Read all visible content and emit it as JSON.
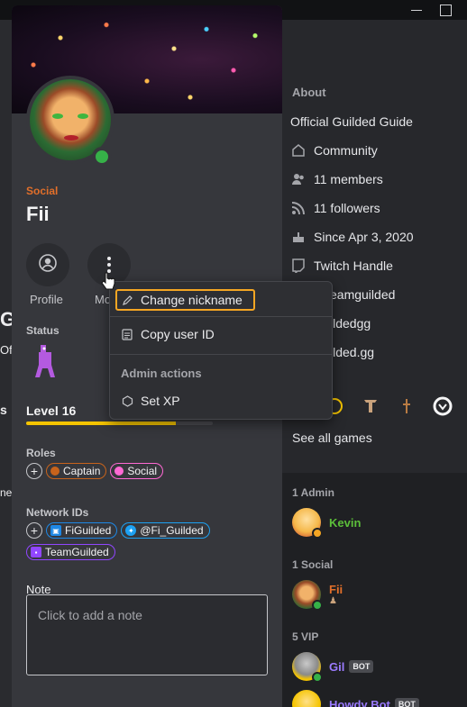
{
  "background": {
    "left_fragments": [
      "Gu",
      "Offi",
      "s",
      "ne."
    ],
    "about": {
      "title": "About",
      "rows": [
        {
          "icon": "",
          "text": "Official Guilded Guide"
        },
        {
          "icon": "community-icon",
          "text": "Community"
        },
        {
          "icon": "members-icon",
          "text": "11 members"
        },
        {
          "icon": "followers-icon",
          "text": "11 followers"
        },
        {
          "icon": "cake-icon",
          "text": "Since Apr 3, 2020"
        },
        {
          "icon": "twitch-icon",
          "text": "Twitch Handle"
        },
        {
          "icon": "",
          "text": "eamguilded"
        },
        {
          "icon": "",
          "text": "ildedgg"
        },
        {
          "icon": "",
          "text": "ilded.gg"
        }
      ],
      "see_all_games": "See all games"
    },
    "members": {
      "sections": [
        {
          "title": "1 Admin",
          "members": [
            {
              "name": "Kevin",
              "color": "#5cbf3a",
              "status": "#f5a623"
            }
          ]
        },
        {
          "title": "1 Social",
          "members": [
            {
              "name": "Fii",
              "color": "#e26f2a",
              "status": "#36b148"
            }
          ]
        },
        {
          "title": "5 VIP",
          "members": [
            {
              "name": "Gil",
              "color": "#9b7bff",
              "status": "#36b148",
              "tag": "BOT"
            },
            {
              "name": "Howdy Bot",
              "color": "#9b7bff",
              "status": "#36b148",
              "tag": "BOT"
            }
          ]
        }
      ]
    }
  },
  "profile": {
    "role_label": "Social",
    "name": "Fii",
    "actions": {
      "profile_label": "Profile",
      "more_label": "Mo"
    },
    "status_title": "Status",
    "level": {
      "label": "Level 16",
      "progress": 0.8
    },
    "roles": {
      "title": "Roles",
      "items": [
        {
          "label": "Captain",
          "color": "#c7631c"
        },
        {
          "label": "Social",
          "color": "#ff69d4"
        }
      ]
    },
    "network": {
      "title": "Network IDs",
      "items": [
        {
          "label": "FiGuilded",
          "icon": "roblox-icon",
          "color": "#1e88e5"
        },
        {
          "label": "@Fi_Guilded",
          "icon": "twitter-icon",
          "color": "#1da1f2"
        },
        {
          "label": "TeamGuilded",
          "icon": "twitch-icon",
          "color": "#9146ff"
        }
      ]
    },
    "note": {
      "title": "Note",
      "placeholder": "Click to add a note"
    }
  },
  "menu": {
    "items": [
      {
        "label": "Change nickname",
        "icon": "pencil-icon"
      },
      {
        "label": "Copy user ID",
        "icon": "clipboard-icon"
      }
    ],
    "admin_header": "Admin actions",
    "admin_items": [
      {
        "label": "Set XP",
        "icon": "xp-icon"
      }
    ]
  },
  "colors": {
    "accent": "#f5a623",
    "level_fill": "#f5c400",
    "online": "#36b148"
  }
}
